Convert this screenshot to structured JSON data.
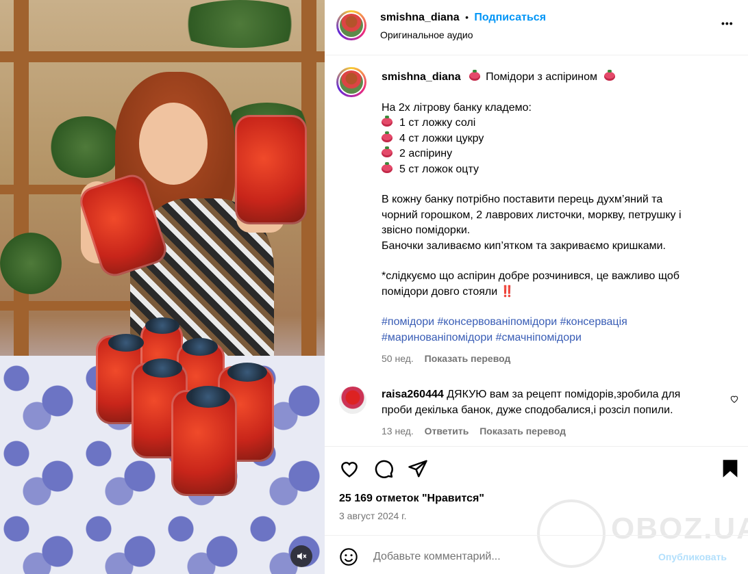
{
  "post": {
    "username": "smishna_diana",
    "separator": "•",
    "follow_label": "Подписаться",
    "audio": "Оригинальное аудио",
    "more": "•••"
  },
  "caption": {
    "username": "smishna_diana",
    "title": "Помідори з аспірином",
    "intro": "На 2х літрову банку кладемо:",
    "ingredients": [
      "1 ст ложку солі",
      "4 ст ложки цукру",
      "2 аспірину",
      "5 ст ложок оцту"
    ],
    "paragraph1_line1": "В кожну банку потрібно поставити перець духм’яний та",
    "paragraph1_line2": "чорний горошком, 2 лаврових листочки, моркву, петрушку і",
    "paragraph1_line3": "звісно помідорки.",
    "paragraph1_line4": "Баночки заливаємо кип’ятком та закриваємо кришками.",
    "note_line1": "*слідкуємо що аспірин добре розчинився, це важливо щоб",
    "note_line2": "помідори довго стояли",
    "note_mark": "‼️",
    "hashtags_line1": "#помідори #консервованіпомідори #консервація",
    "hashtags_line2": "#маринованіпомідори #смачніпомідори",
    "age": "50 нед.",
    "translate": "Показать перевод"
  },
  "comment": {
    "username": "raisa260444",
    "text_line1": "ДЯКУЮ вам за рецепт помідорів,зробила для",
    "text_line2": "проби декілька банок, дуже сподобалися,і розсіл попили.",
    "age": "13 нед.",
    "reply": "Ответить",
    "translate": "Показать перевод"
  },
  "actions": {
    "icons": [
      "heart-icon",
      "comment-icon",
      "share-icon",
      "bookmark-icon"
    ],
    "likes": "25 169 отметок \"Нравится\"",
    "date": "3 август 2024 г."
  },
  "add_comment": {
    "placeholder": "Добавьте комментарий...",
    "publish": "Опубликовать"
  },
  "watermark": "OBOZ.UA",
  "colors": {
    "accent": "#0095f6",
    "hashtag": "#385cb5",
    "muted": "#737373"
  }
}
